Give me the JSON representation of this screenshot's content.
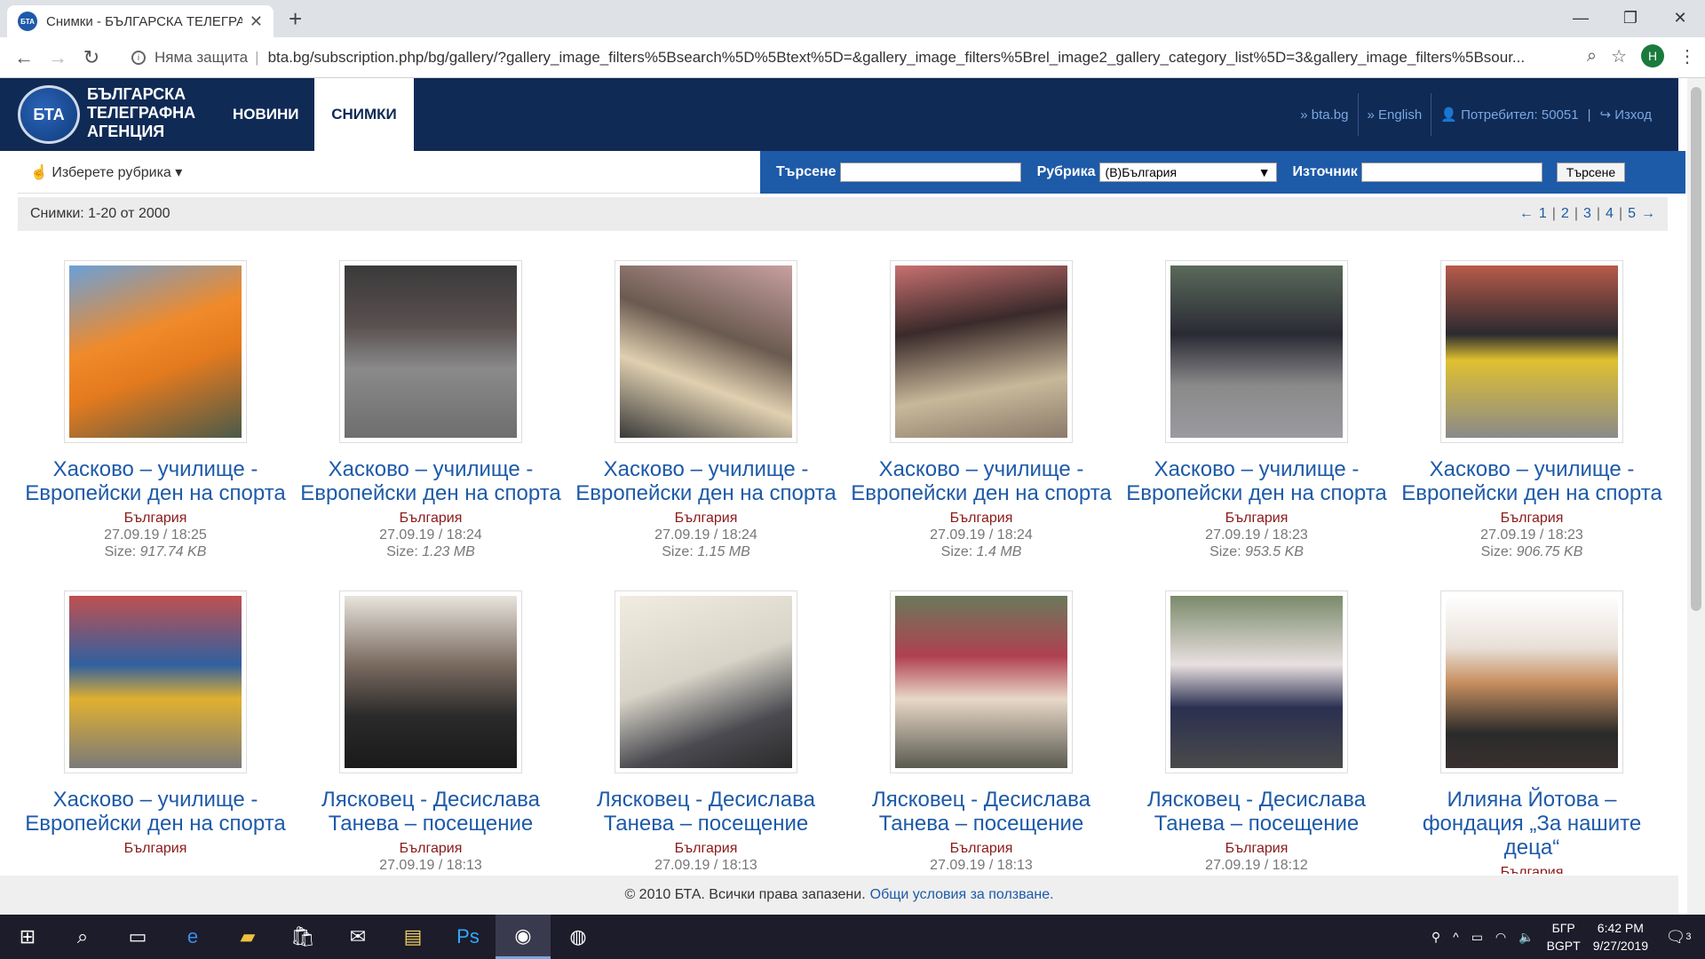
{
  "browser": {
    "tab_title": "Снимки - БЪЛГАРСКА ТЕЛЕГРА",
    "security_label": "Няма защита",
    "url": "bta.bg/subscription.php/bg/gallery/?gallery_image_filters%5Bsearch%5D%5Btext%5D=&gallery_image_filters%5Brel_image2_gallery_category_list%5D=3&gallery_image_filters%5Bsour...",
    "profile_initial": "H"
  },
  "site": {
    "logo_text": "БТА",
    "agency_name_1": "БЪЛГАРСКА",
    "agency_name_2": "ТЕЛЕГРАФНА",
    "agency_name_3": "АГЕНЦИЯ",
    "nav_news": "НОВИНИ",
    "nav_photos": "СНИМКИ",
    "link_bta": "» bta.bg",
    "link_english": "» English",
    "user_label": "Потребител: 50051",
    "logout_label": "Изход"
  },
  "filters": {
    "rubric_dropdown": "Изберете рубрика",
    "search_label": "Търсене",
    "search_value": "",
    "category_label": "Рубрика",
    "category_value": "(В)България",
    "source_label": "Източник",
    "source_value": "",
    "search_button": "Търсене"
  },
  "results": {
    "summary": "Снимки: 1-20 от 2000",
    "pages": [
      "1",
      "2",
      "3",
      "4",
      "5"
    ]
  },
  "photos": [
    {
      "title": "Хасково – училище - Европейски ден на спорта",
      "category": "България",
      "datetime": "27.09.19 / 18:25",
      "size_label": "Size:",
      "size": "917.74 KB"
    },
    {
      "title": "Хасково – училище - Европейски ден на спорта",
      "category": "България",
      "datetime": "27.09.19 / 18:24",
      "size_label": "Size:",
      "size": "1.23 MB"
    },
    {
      "title": "Хасково – училище - Европейски ден на спорта",
      "category": "България",
      "datetime": "27.09.19 / 18:24",
      "size_label": "Size:",
      "size": "1.15 MB"
    },
    {
      "title": "Хасково – училище - Европейски ден на спорта",
      "category": "България",
      "datetime": "27.09.19 / 18:24",
      "size_label": "Size:",
      "size": "1.4 MB"
    },
    {
      "title": "Хасково – училище - Европейски ден на спорта",
      "category": "България",
      "datetime": "27.09.19 / 18:23",
      "size_label": "Size:",
      "size": "953.5 KB"
    },
    {
      "title": "Хасково – училище - Европейски ден на спорта",
      "category": "България",
      "datetime": "27.09.19 / 18:23",
      "size_label": "Size:",
      "size": "906.75 KB"
    },
    {
      "title": "Хасково – училище - Европейски ден на спорта",
      "category": "България",
      "datetime": "",
      "size_label": "",
      "size": ""
    },
    {
      "title": "Лясковец - Десислава Танева – посещение",
      "category": "България",
      "datetime": "27.09.19 / 18:13",
      "size_label": "",
      "size": ""
    },
    {
      "title": "Лясковец - Десислава Танева – посещение",
      "category": "България",
      "datetime": "27.09.19 / 18:13",
      "size_label": "",
      "size": ""
    },
    {
      "title": "Лясковец - Десислава Танева – посещение",
      "category": "България",
      "datetime": "27.09.19 / 18:13",
      "size_label": "",
      "size": ""
    },
    {
      "title": "Лясковец - Десислава Танева – посещение",
      "category": "България",
      "datetime": "27.09.19 / 18:12",
      "size_label": "",
      "size": ""
    },
    {
      "title": "Илияна Йотова – фондация „За нашите деца“",
      "category": "България",
      "datetime": "",
      "size_label": "",
      "size": ""
    }
  ],
  "footer": {
    "copyright": "© 2010 БТА. Всички права запазени.",
    "terms_link": "Общи условия за ползване."
  },
  "taskbar": {
    "language": "БГР",
    "locale": "BGPT",
    "time": "6:42 PM",
    "date": "9/27/2019",
    "notifications": "3"
  },
  "colors": {
    "header_bg": "#0f2a55",
    "accent_blue": "#1d5aa8",
    "category_red": "#8b1a1a"
  }
}
